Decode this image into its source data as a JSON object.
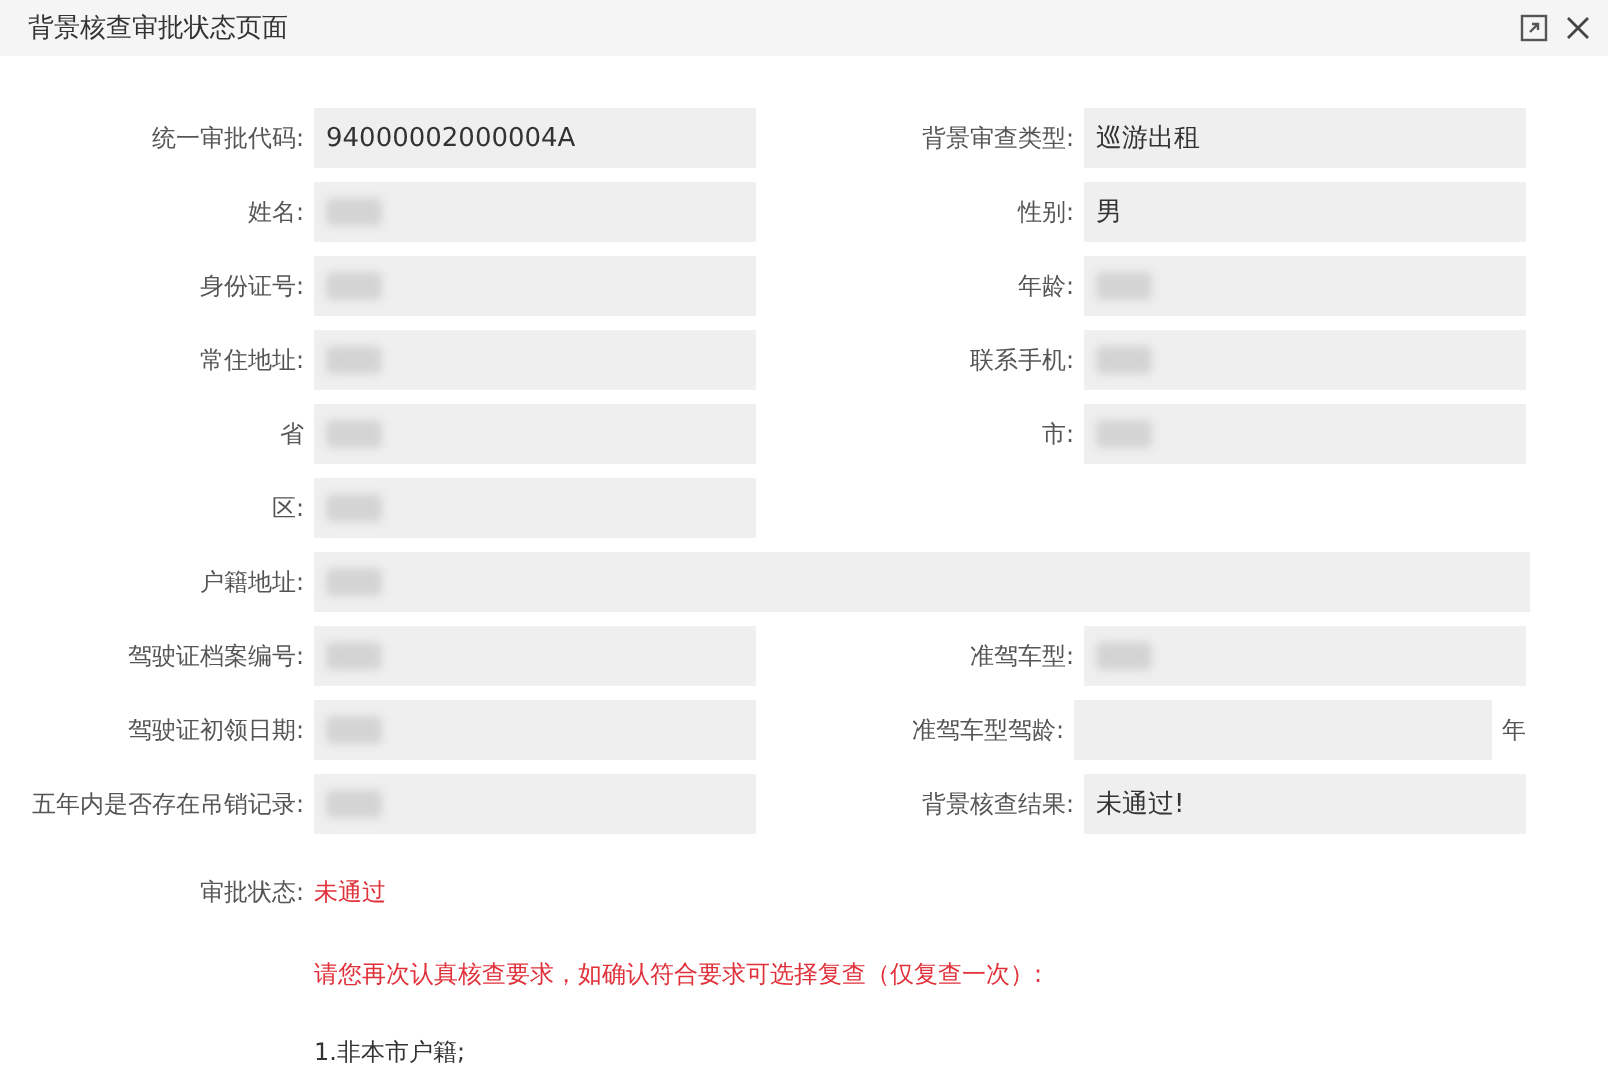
{
  "window": {
    "title": "背景核查审批状态页面"
  },
  "rows": [
    {
      "kind": "pair",
      "cells": [
        {
          "label": "统一审批代码:",
          "value": "94000002000004A"
        },
        {
          "label": "背景审查类型:",
          "value": "巡游出租"
        }
      ]
    },
    {
      "kind": "pair",
      "cells": [
        {
          "label": "姓名:",
          "redacted": true
        },
        {
          "label": "性别:",
          "value": "男"
        }
      ]
    },
    {
      "kind": "pair",
      "cells": [
        {
          "label": "身份证号:",
          "redacted": true
        },
        {
          "label": "年龄:",
          "redacted": true
        }
      ]
    },
    {
      "kind": "pair",
      "cells": [
        {
          "label": "常住地址:",
          "redacted": true
        },
        {
          "label": "联系手机:",
          "redacted": true
        }
      ]
    },
    {
      "kind": "pair",
      "cells": [
        {
          "label": "省",
          "redacted": true
        },
        {
          "label": "市:",
          "redacted": true
        }
      ]
    },
    {
      "kind": "pair",
      "cells": [
        {
          "label": "区:",
          "redacted": true
        }
      ]
    },
    {
      "kind": "full",
      "cells": [
        {
          "label": "户籍地址:",
          "redacted": true
        }
      ]
    },
    {
      "kind": "pair",
      "cells": [
        {
          "label": "驾驶证档案编号:",
          "redacted": true
        },
        {
          "label": "准驾车型:",
          "redacted": true
        }
      ]
    },
    {
      "kind": "pair",
      "cells": [
        {
          "label": "驾驶证初领日期:",
          "redacted": true
        },
        {
          "label": "准驾车型驾龄:",
          "suffix": "年"
        }
      ]
    },
    {
      "kind": "pair",
      "cells": [
        {
          "label": "五年内是否存在吊销记录:",
          "redacted": true
        },
        {
          "label": "背景核查结果:",
          "value": "未通过!"
        }
      ]
    }
  ],
  "status": {
    "label": "审批状态:",
    "value": "未通过"
  },
  "message": "请您再次认真核查要求，如确认符合要求可选择复查（仅复查一次）:",
  "requirements": [
    "1.非本市户籍;"
  ]
}
